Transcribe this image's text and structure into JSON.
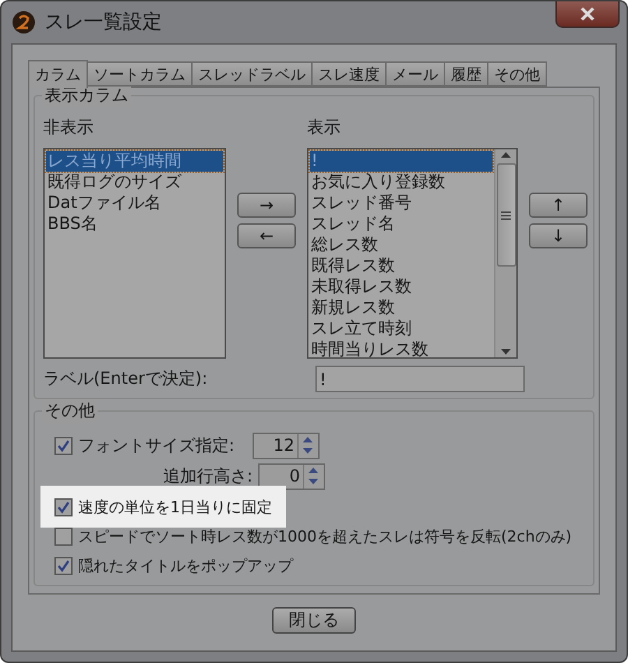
{
  "window": {
    "title": "スレ一覧設定"
  },
  "tabs": [
    {
      "label": "カラム",
      "selected": true
    },
    {
      "label": "ソートカラム",
      "selected": false
    },
    {
      "label": "スレッドラベル",
      "selected": false
    },
    {
      "label": "スレ速度",
      "selected": false
    },
    {
      "label": "メール",
      "selected": false
    },
    {
      "label": "履歴",
      "selected": false
    },
    {
      "label": "その他",
      "selected": false
    }
  ],
  "columns_group": {
    "title": "表示カラム",
    "hidden_label": "非表示",
    "hidden_items": [
      {
        "label": "レス当り平均時間",
        "selected": true
      },
      {
        "label": "既得ログのサイズ",
        "selected": false
      },
      {
        "label": "Datファイル名",
        "selected": false
      },
      {
        "label": "BBS名",
        "selected": false
      }
    ],
    "shown_label": "表示",
    "shown_items": [
      {
        "label": "!",
        "selected": true
      },
      {
        "label": "お気に入り登録数",
        "selected": false
      },
      {
        "label": "スレッド番号",
        "selected": false
      },
      {
        "label": "スレッド名",
        "selected": false
      },
      {
        "label": "総レス数",
        "selected": false
      },
      {
        "label": "既得レス数",
        "selected": false
      },
      {
        "label": "未取得レス数",
        "selected": false
      },
      {
        "label": "新規レス数",
        "selected": false
      },
      {
        "label": "スレ立て時刻",
        "selected": false
      },
      {
        "label": "時間当りレス数",
        "selected": false
      }
    ],
    "move_buttons": [
      "→",
      "←"
    ],
    "order_buttons": [
      "↑",
      "↓"
    ],
    "label_field": {
      "label": "ラベル(Enterで決定):",
      "value": "!"
    }
  },
  "other_group": {
    "title": "その他",
    "font_size": {
      "label": "フォントサイズ指定:",
      "checked": true,
      "value": "12"
    },
    "extra_line_height": {
      "label": "追加行高さ:",
      "value": "0"
    },
    "options": [
      {
        "label": "速度の単位を1日当りに固定",
        "checked": true,
        "highlighted": true
      },
      {
        "label": "スピードでソート時レス数が1000を超えたスレは符号を反転(2chのみ)",
        "checked": false,
        "highlighted": false
      },
      {
        "label": "隠れたタイトルをポップアップ",
        "checked": true,
        "highlighted": false
      }
    ]
  },
  "close_button": "閉じる"
}
